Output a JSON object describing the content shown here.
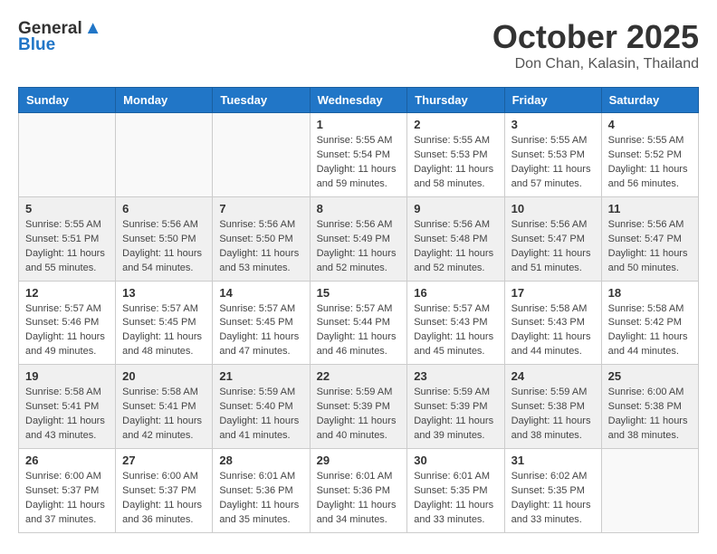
{
  "header": {
    "logo_general": "General",
    "logo_blue": "Blue",
    "month": "October 2025",
    "location": "Don Chan, Kalasin, Thailand"
  },
  "weekdays": [
    "Sunday",
    "Monday",
    "Tuesday",
    "Wednesday",
    "Thursday",
    "Friday",
    "Saturday"
  ],
  "weeks": [
    [
      {
        "day": "",
        "info": ""
      },
      {
        "day": "",
        "info": ""
      },
      {
        "day": "",
        "info": ""
      },
      {
        "day": "1",
        "info": "Sunrise: 5:55 AM\nSunset: 5:54 PM\nDaylight: 11 hours\nand 59 minutes."
      },
      {
        "day": "2",
        "info": "Sunrise: 5:55 AM\nSunset: 5:53 PM\nDaylight: 11 hours\nand 58 minutes."
      },
      {
        "day": "3",
        "info": "Sunrise: 5:55 AM\nSunset: 5:53 PM\nDaylight: 11 hours\nand 57 minutes."
      },
      {
        "day": "4",
        "info": "Sunrise: 5:55 AM\nSunset: 5:52 PM\nDaylight: 11 hours\nand 56 minutes."
      }
    ],
    [
      {
        "day": "5",
        "info": "Sunrise: 5:55 AM\nSunset: 5:51 PM\nDaylight: 11 hours\nand 55 minutes."
      },
      {
        "day": "6",
        "info": "Sunrise: 5:56 AM\nSunset: 5:50 PM\nDaylight: 11 hours\nand 54 minutes."
      },
      {
        "day": "7",
        "info": "Sunrise: 5:56 AM\nSunset: 5:50 PM\nDaylight: 11 hours\nand 53 minutes."
      },
      {
        "day": "8",
        "info": "Sunrise: 5:56 AM\nSunset: 5:49 PM\nDaylight: 11 hours\nand 52 minutes."
      },
      {
        "day": "9",
        "info": "Sunrise: 5:56 AM\nSunset: 5:48 PM\nDaylight: 11 hours\nand 52 minutes."
      },
      {
        "day": "10",
        "info": "Sunrise: 5:56 AM\nSunset: 5:47 PM\nDaylight: 11 hours\nand 51 minutes."
      },
      {
        "day": "11",
        "info": "Sunrise: 5:56 AM\nSunset: 5:47 PM\nDaylight: 11 hours\nand 50 minutes."
      }
    ],
    [
      {
        "day": "12",
        "info": "Sunrise: 5:57 AM\nSunset: 5:46 PM\nDaylight: 11 hours\nand 49 minutes."
      },
      {
        "day": "13",
        "info": "Sunrise: 5:57 AM\nSunset: 5:45 PM\nDaylight: 11 hours\nand 48 minutes."
      },
      {
        "day": "14",
        "info": "Sunrise: 5:57 AM\nSunset: 5:45 PM\nDaylight: 11 hours\nand 47 minutes."
      },
      {
        "day": "15",
        "info": "Sunrise: 5:57 AM\nSunset: 5:44 PM\nDaylight: 11 hours\nand 46 minutes."
      },
      {
        "day": "16",
        "info": "Sunrise: 5:57 AM\nSunset: 5:43 PM\nDaylight: 11 hours\nand 45 minutes."
      },
      {
        "day": "17",
        "info": "Sunrise: 5:58 AM\nSunset: 5:43 PM\nDaylight: 11 hours\nand 44 minutes."
      },
      {
        "day": "18",
        "info": "Sunrise: 5:58 AM\nSunset: 5:42 PM\nDaylight: 11 hours\nand 44 minutes."
      }
    ],
    [
      {
        "day": "19",
        "info": "Sunrise: 5:58 AM\nSunset: 5:41 PM\nDaylight: 11 hours\nand 43 minutes."
      },
      {
        "day": "20",
        "info": "Sunrise: 5:58 AM\nSunset: 5:41 PM\nDaylight: 11 hours\nand 42 minutes."
      },
      {
        "day": "21",
        "info": "Sunrise: 5:59 AM\nSunset: 5:40 PM\nDaylight: 11 hours\nand 41 minutes."
      },
      {
        "day": "22",
        "info": "Sunrise: 5:59 AM\nSunset: 5:39 PM\nDaylight: 11 hours\nand 40 minutes."
      },
      {
        "day": "23",
        "info": "Sunrise: 5:59 AM\nSunset: 5:39 PM\nDaylight: 11 hours\nand 39 minutes."
      },
      {
        "day": "24",
        "info": "Sunrise: 5:59 AM\nSunset: 5:38 PM\nDaylight: 11 hours\nand 38 minutes."
      },
      {
        "day": "25",
        "info": "Sunrise: 6:00 AM\nSunset: 5:38 PM\nDaylight: 11 hours\nand 38 minutes."
      }
    ],
    [
      {
        "day": "26",
        "info": "Sunrise: 6:00 AM\nSunset: 5:37 PM\nDaylight: 11 hours\nand 37 minutes."
      },
      {
        "day": "27",
        "info": "Sunrise: 6:00 AM\nSunset: 5:37 PM\nDaylight: 11 hours\nand 36 minutes."
      },
      {
        "day": "28",
        "info": "Sunrise: 6:01 AM\nSunset: 5:36 PM\nDaylight: 11 hours\nand 35 minutes."
      },
      {
        "day": "29",
        "info": "Sunrise: 6:01 AM\nSunset: 5:36 PM\nDaylight: 11 hours\nand 34 minutes."
      },
      {
        "day": "30",
        "info": "Sunrise: 6:01 AM\nSunset: 5:35 PM\nDaylight: 11 hours\nand 33 minutes."
      },
      {
        "day": "31",
        "info": "Sunrise: 6:02 AM\nSunset: 5:35 PM\nDaylight: 11 hours\nand 33 minutes."
      },
      {
        "day": "",
        "info": ""
      }
    ]
  ]
}
